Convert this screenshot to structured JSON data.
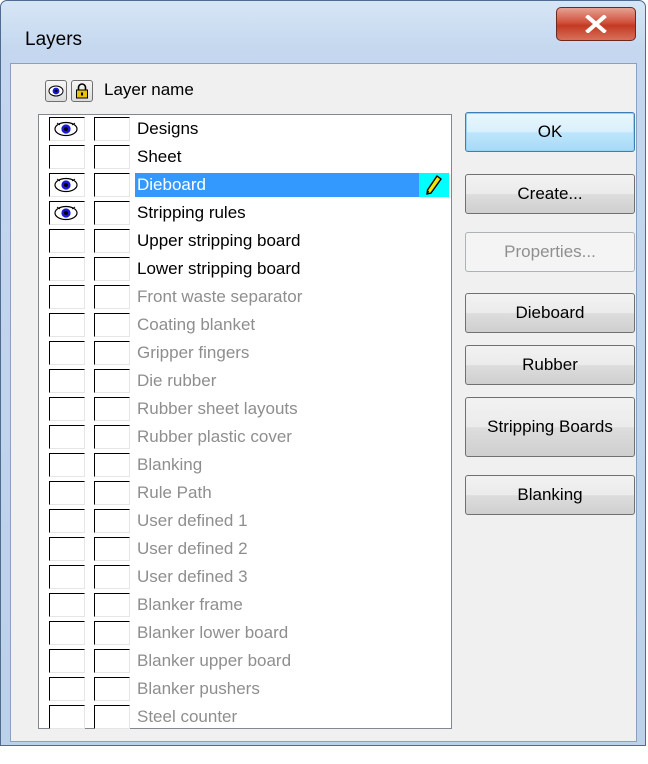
{
  "window": {
    "title": "Layers",
    "close_symbol": "x"
  },
  "header": {
    "layer_name_label": "Layer name"
  },
  "layers": [
    {
      "name": "Designs",
      "visible": true,
      "active": true
    },
    {
      "name": "Sheet",
      "visible": false,
      "active": true
    },
    {
      "name": "Dieboard",
      "visible": true,
      "active": true,
      "selected": true,
      "editing": true
    },
    {
      "name": "Stripping rules",
      "visible": true,
      "active": true
    },
    {
      "name": "Upper stripping board",
      "visible": false,
      "active": true
    },
    {
      "name": "Lower stripping board",
      "visible": false,
      "active": true
    },
    {
      "name": "Front waste separator",
      "visible": false,
      "active": false
    },
    {
      "name": "Coating blanket",
      "visible": false,
      "active": false
    },
    {
      "name": "Gripper fingers",
      "visible": false,
      "active": false
    },
    {
      "name": "Die rubber",
      "visible": false,
      "active": false
    },
    {
      "name": "Rubber sheet layouts",
      "visible": false,
      "active": false
    },
    {
      "name": "Rubber plastic cover",
      "visible": false,
      "active": false
    },
    {
      "name": "Blanking",
      "visible": false,
      "active": false
    },
    {
      "name": "Rule Path",
      "visible": false,
      "active": false
    },
    {
      "name": "User defined 1",
      "visible": false,
      "active": false
    },
    {
      "name": "User defined 2",
      "visible": false,
      "active": false
    },
    {
      "name": "User defined 3",
      "visible": false,
      "active": false
    },
    {
      "name": "Blanker frame",
      "visible": false,
      "active": false
    },
    {
      "name": "Blanker lower board",
      "visible": false,
      "active": false
    },
    {
      "name": "Blanker upper board",
      "visible": false,
      "active": false
    },
    {
      "name": "Blanker pushers",
      "visible": false,
      "active": false
    },
    {
      "name": "Steel counter",
      "visible": false,
      "active": false
    }
  ],
  "buttons": {
    "ok": "OK",
    "create": "Create...",
    "properties": "Properties...",
    "dieboard": "Dieboard",
    "rubber": "Rubber",
    "stripping_boards": "Stripping Boards",
    "blanking": "Blanking"
  },
  "colors": {
    "selection": "#3399ff",
    "edit_marker": "#00ffff",
    "eye": "#1a1ad6",
    "lock": "#e8c400",
    "inactive_text": "#8e8e8e"
  },
  "icons": {
    "visibility": "eye-icon",
    "lock": "lock-icon",
    "edit": "pencil-icon",
    "close": "close-icon"
  }
}
